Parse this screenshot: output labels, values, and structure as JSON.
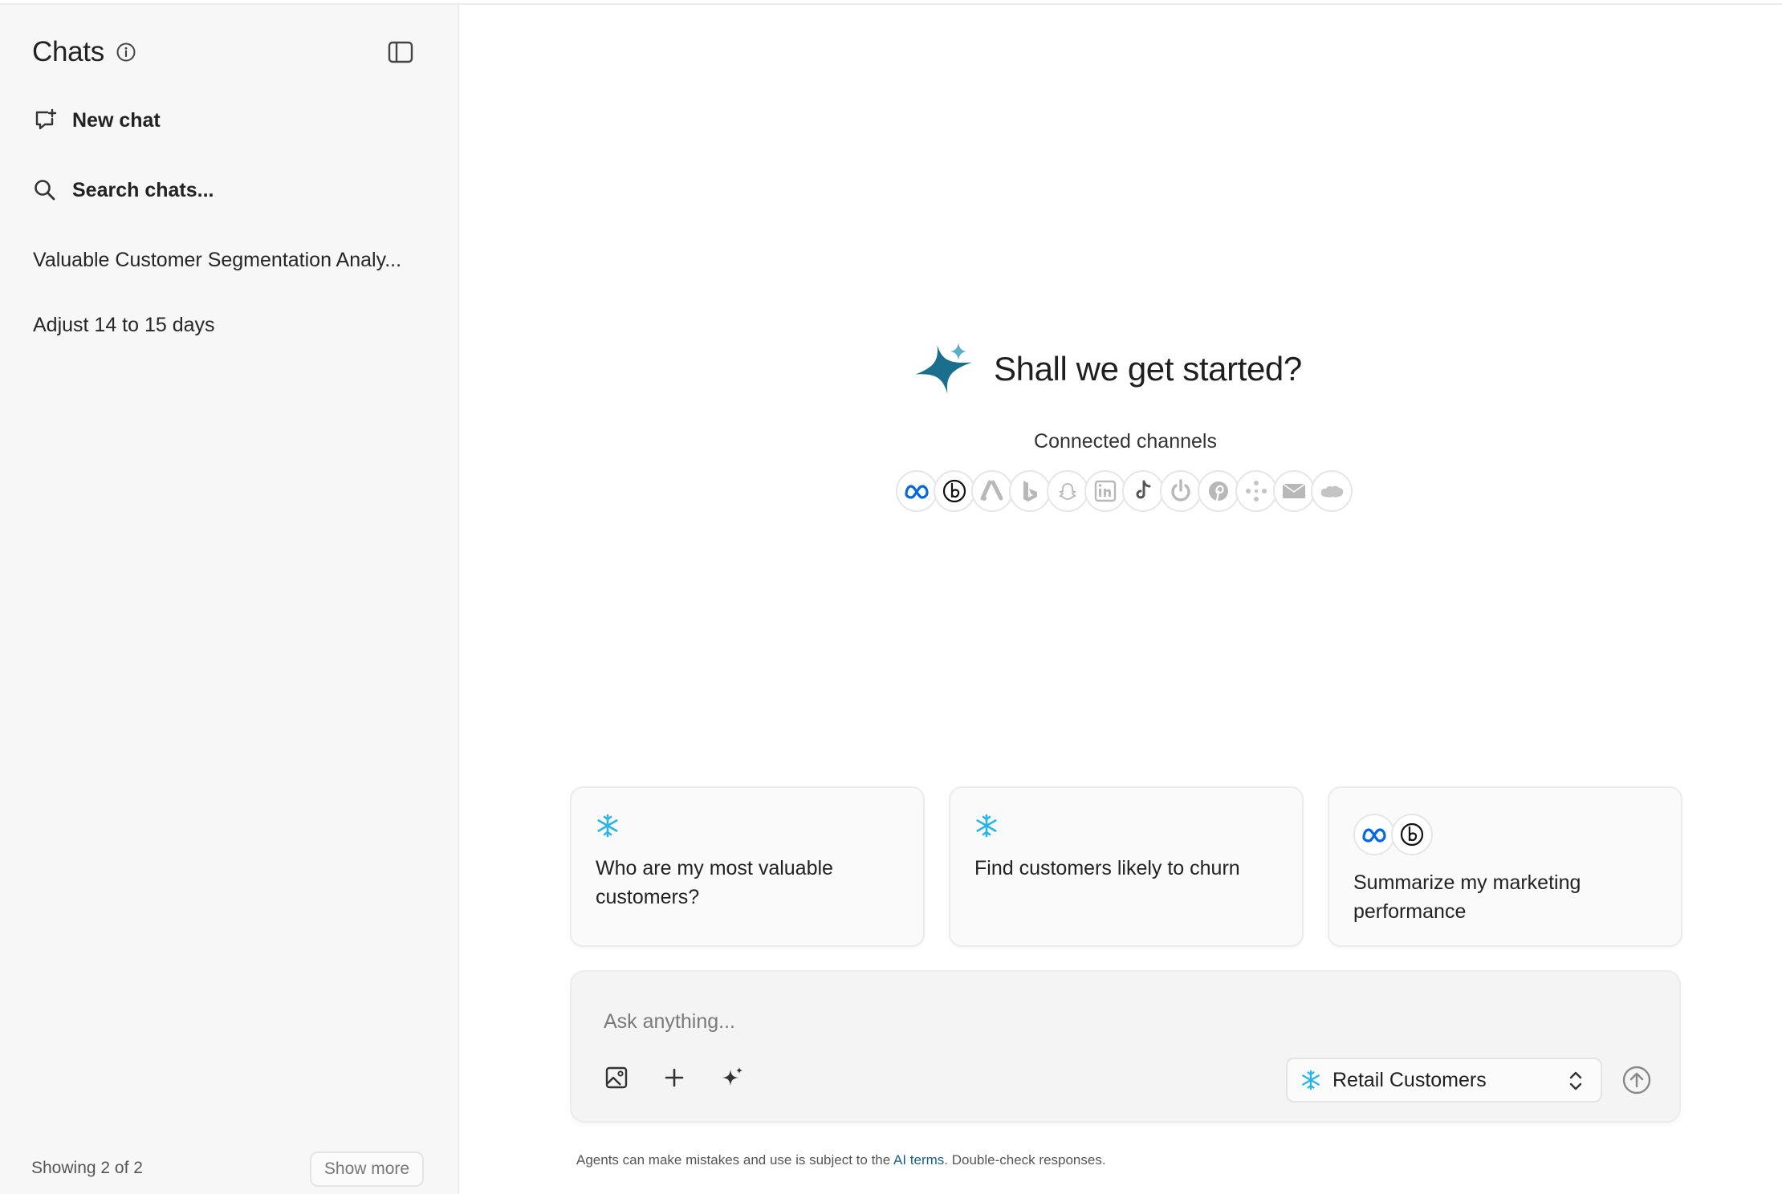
{
  "sidebar": {
    "title": "Chats",
    "new_chat": "New chat",
    "search": "Search chats...",
    "chats": [
      "Valuable Customer Segmentation Analy...",
      "Adjust 14 to 15 days"
    ],
    "showing": "Showing 2 of 2",
    "show_more": "Show more"
  },
  "main": {
    "greeting": "Shall we get started?",
    "channels_label": "Connected channels",
    "channels": [
      "meta-icon",
      "bluesky-icon",
      "google-ads-icon",
      "bing-icon",
      "snapchat-icon",
      "linkedin-icon",
      "tiktok-icon",
      "power-icon",
      "pinterest-icon",
      "dots-icon",
      "email-icon",
      "salesforce-icon"
    ],
    "cards": [
      {
        "text": "Who are my most valuable customers?",
        "icon": "snowflake-icon"
      },
      {
        "text": "Find customers likely to churn",
        "icon": "snowflake-icon"
      },
      {
        "text": "Summarize my marketing performance",
        "icon": "meta-icon"
      }
    ]
  },
  "composer": {
    "placeholder": "Ask anything...",
    "source": "Retail Customers"
  },
  "disclaimer": {
    "before": "Agents can make mistakes and use is subject to the ",
    "link": "AI terms",
    "after": ". Double-check responses."
  },
  "colors": {
    "accent": "#1a6f8f",
    "snowflake": "#29b5e8",
    "meta": "#0668e1"
  }
}
